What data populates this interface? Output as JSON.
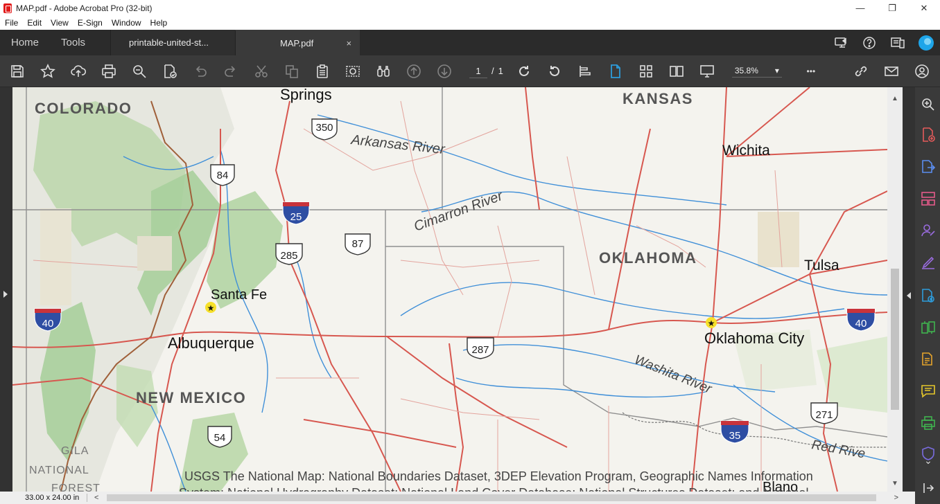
{
  "window": {
    "title": "MAP.pdf - Adobe Acrobat Pro (32-bit)",
    "minimize": "—",
    "restore": "❐",
    "close": "✕"
  },
  "menu": [
    "File",
    "Edit",
    "View",
    "E-Sign",
    "Window",
    "Help"
  ],
  "tabs": {
    "home": "Home",
    "tools": "Tools",
    "doc1": "printable-united-st...",
    "doc2": "MAP.pdf",
    "close_glyph": "×"
  },
  "toolbar": {
    "page_current": "1",
    "page_sep": "/",
    "page_total": "1",
    "zoom": "35.8%",
    "zoom_caret": "▾",
    "more": "•••"
  },
  "map": {
    "states": [
      "COLORADO",
      "KANSAS",
      "OKLAHOMA",
      "NEW MEXICO"
    ],
    "cities": [
      "Springs",
      "Wichita",
      "Santa Fe",
      "Albuquerque",
      "Tulsa",
      "Oklahoma City"
    ],
    "rivers": [
      "Arkansas River",
      "Cimarron River",
      "Washita River",
      "Red Rive"
    ],
    "forest": [
      "GILA",
      "NATIONAL",
      "FOREST"
    ],
    "routes": [
      "350",
      "84",
      "25",
      "87",
      "285",
      "40",
      "287",
      "54",
      "40",
      "271",
      "35"
    ],
    "credit_line1": "USGS The National Map: National Boundaries Dataset, 3DEP Elevation Program, Geographic Names Information",
    "credit_line2": "System; National Hydrography Dataset; National Land Cover Database; National Structures Dataset; and National",
    "blano": "Blano"
  },
  "status": {
    "page_size": "33.00 x 24.00 in",
    "left_arrow": "<",
    "right_arrow": ">"
  },
  "colors": {
    "accent_blue": "#2d9cdb",
    "pdf_red": "#e21b1b",
    "road_red": "#d7574f",
    "river_blue": "#3f8fd8",
    "forest_green": "#a9cf9c",
    "right_tool_orange": "#e6a42b",
    "right_tool_purple": "#9a6ce0",
    "right_tool_green": "#3fb34f"
  }
}
